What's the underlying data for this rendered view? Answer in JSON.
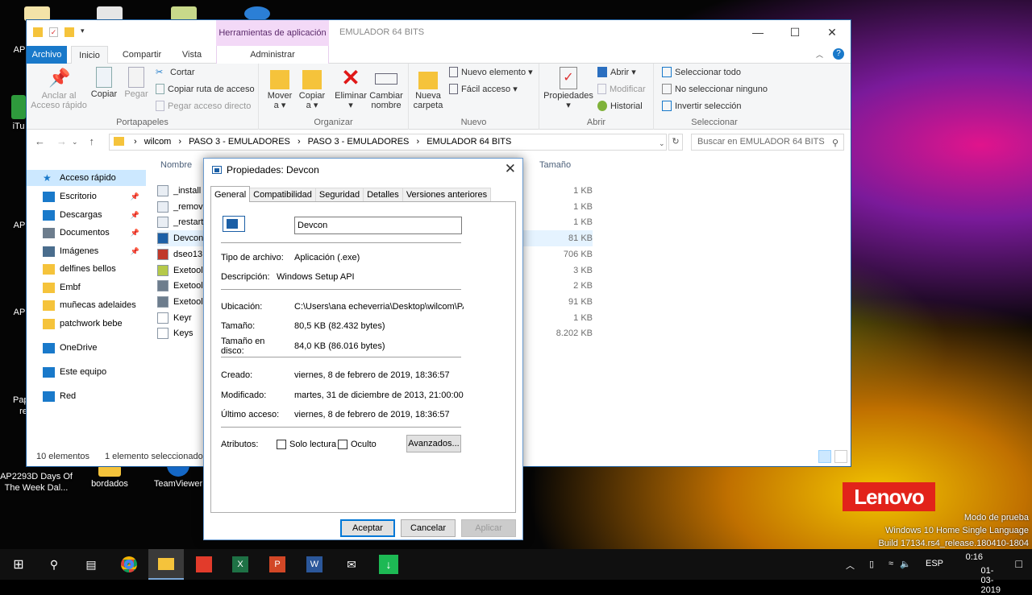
{
  "desktop": {
    "icons": [
      {
        "label": "AP2293D Days Of The Week Dal..."
      },
      {
        "label": "bordados"
      },
      {
        "label": "TeamViewer"
      }
    ],
    "partial_labels": [
      "AP",
      "iTu",
      "AP",
      "AP",
      "Pap",
      "re"
    ]
  },
  "explorer": {
    "title": "EMULADOR 64 BITS",
    "context_group": "Herramientas de aplicación",
    "tabs": {
      "archivo": "Archivo",
      "inicio": "Inicio",
      "compartir": "Compartir",
      "vista": "Vista",
      "administrar": "Administrar"
    },
    "ribbon": {
      "portapapeles": {
        "label": "Portapapeles",
        "anclar": "Anclar al\nAcceso rápido",
        "copiar": "Copiar",
        "pegar": "Pegar",
        "cortar": "Cortar",
        "copiar_ruta": "Copiar ruta de acceso",
        "pegar_acceso": "Pegar acceso directo"
      },
      "organizar": {
        "label": "Organizar",
        "mover": "Mover\na ▾",
        "copiar_a": "Copiar\na ▾",
        "eliminar": "Eliminar\n▾",
        "cambiar": "Cambiar\nnombre"
      },
      "nuevo": {
        "label": "Nuevo",
        "nueva_carpeta": "Nueva\ncarpeta",
        "nuevo_elemento": "Nuevo elemento ▾",
        "facil_acceso": "Fácil acceso ▾"
      },
      "abrir": {
        "label": "Abrir",
        "propiedades": "Propiedades\n▾",
        "abrir": "Abrir ▾",
        "modificar": "Modificar",
        "historial": "Historial"
      },
      "seleccionar": {
        "label": "Seleccionar",
        "todo": "Seleccionar todo",
        "ninguno": "No seleccionar ninguno",
        "invertir": "Invertir selección"
      }
    },
    "address": {
      "parts": [
        "wilcom",
        "PASO 3 - EMULADORES",
        "PASO 3 - EMULADORES",
        "EMULADOR 64 BITS"
      ]
    },
    "search_placeholder": "Buscar en EMULADOR 64 BITS",
    "nav": [
      {
        "label": "Acceso rápido",
        "icon": "star-icon",
        "color": "#1979ca"
      },
      {
        "label": "Escritorio",
        "icon": "desktop-icon",
        "color": "#1979ca",
        "pinned": true
      },
      {
        "label": "Descargas",
        "icon": "download-icon",
        "color": "#1979ca",
        "pinned": true
      },
      {
        "label": "Documentos",
        "icon": "documents-icon",
        "color": "#6d7d8d",
        "pinned": true
      },
      {
        "label": "Imágenes",
        "icon": "pictures-icon",
        "color": "#4a6d8d",
        "pinned": true
      },
      {
        "label": "delfines bellos",
        "icon": "folder-icon",
        "color": "#f5c33b"
      },
      {
        "label": "Embf",
        "icon": "folder-icon",
        "color": "#f5c33b"
      },
      {
        "label": "muñecas adelaides",
        "icon": "folder-icon",
        "color": "#f5c33b"
      },
      {
        "label": "patchwork bebe",
        "icon": "folder-icon",
        "color": "#f5c33b"
      },
      {
        "label": "OneDrive",
        "icon": "cloud-icon",
        "color": "#1979ca"
      },
      {
        "label": "Este equipo",
        "icon": "computer-icon",
        "color": "#1979ca"
      },
      {
        "label": "Red",
        "icon": "network-icon",
        "color": "#1979ca"
      }
    ],
    "columns": {
      "name": "Nombre",
      "size": "Tamaño"
    },
    "files": [
      {
        "name": "_install",
        "size": "1 KB"
      },
      {
        "name": "_remov",
        "size": "1 KB"
      },
      {
        "name": "_restart",
        "size": "1 KB"
      },
      {
        "name": "Devcon",
        "size": "81 KB",
        "selected": true
      },
      {
        "name": "dseo13",
        "size": "706 KB"
      },
      {
        "name": "Exetool",
        "size": "3 KB"
      },
      {
        "name": "Exetool",
        "size": "2 KB"
      },
      {
        "name": "Exetool",
        "size": "91 KB"
      },
      {
        "name": "Keyr",
        "size": "1 KB"
      },
      {
        "name": "Keys",
        "size": "8.202 KB"
      }
    ],
    "status": {
      "count": "10 elementos",
      "selected": "1 elemento seleccionado"
    }
  },
  "dialog": {
    "title": "Propiedades: Devcon",
    "tabs": [
      "General",
      "Compatibilidad",
      "Seguridad",
      "Detalles",
      "Versiones anteriores"
    ],
    "name": "Devcon",
    "labels": {
      "tipo": "Tipo de archivo:",
      "descripcion": "Descripción:",
      "ubicacion": "Ubicación:",
      "tamano": "Tamaño:",
      "tamano_disco": "Tamaño en\ndisco:",
      "creado": "Creado:",
      "modificado": "Modificado:",
      "acceso": "Último acceso:",
      "atributos": "Atributos:"
    },
    "values": {
      "tipo": "Aplicación (.exe)",
      "descripcion": "Windows Setup API",
      "ubicacion": "C:\\Users\\ana echeverria\\Desktop\\wilcom\\PAS",
      "tamano": "80,5 KB (82.432 bytes)",
      "tamano_disco": "84,0 KB (86.016 bytes)",
      "creado": "viernes, 8 de febrero de 2019, 18:36:57",
      "modificado": "martes, 31 de diciembre de 2013, 21:00:00",
      "acceso": "viernes, 8 de febrero de 2019, 18:36:57"
    },
    "attrs": {
      "solo_lectura": "Solo lectura",
      "oculto": "Oculto",
      "avanzados": "Avanzados..."
    },
    "buttons": {
      "aceptar": "Aceptar",
      "cancelar": "Cancelar",
      "aplicar": "Aplicar"
    }
  },
  "watermark": {
    "brand": "Lenovo",
    "line1": "Modo de prueba",
    "line2": "Windows 10 Home Single Language",
    "line3": "Build 17134.rs4_release.180410-1804"
  },
  "taskbar": {
    "lang": "ESP",
    "time": "0:16",
    "date": "01-03-2019"
  }
}
